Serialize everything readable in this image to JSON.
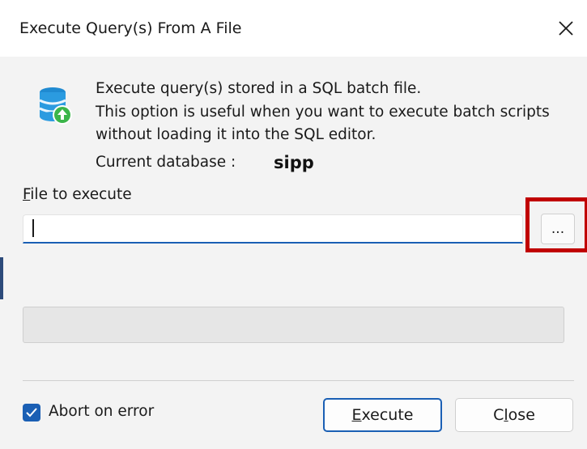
{
  "window": {
    "title": "Execute Query(s) From A File",
    "close_icon": "close-icon"
  },
  "info": {
    "icon": "database-upload-icon",
    "line1": "Execute query(s) stored in a SQL batch file.",
    "line2": "This option is useful when you want to execute batch scripts",
    "line3": "without loading it into the SQL editor."
  },
  "database": {
    "label": "Current database :",
    "value": "sipp"
  },
  "file": {
    "label_access": "F",
    "label_rest": "ile to execute",
    "value": "",
    "browse_label": "..."
  },
  "options": {
    "abort_on_error_label": "Abort on error",
    "abort_on_error_checked": true
  },
  "buttons": {
    "execute_access": "E",
    "execute_rest": "xecute",
    "close_pre": "C",
    "close_access": "l",
    "close_rest": "ose"
  },
  "colors": {
    "accent": "#1a5fb4",
    "highlight": "#c00000"
  }
}
